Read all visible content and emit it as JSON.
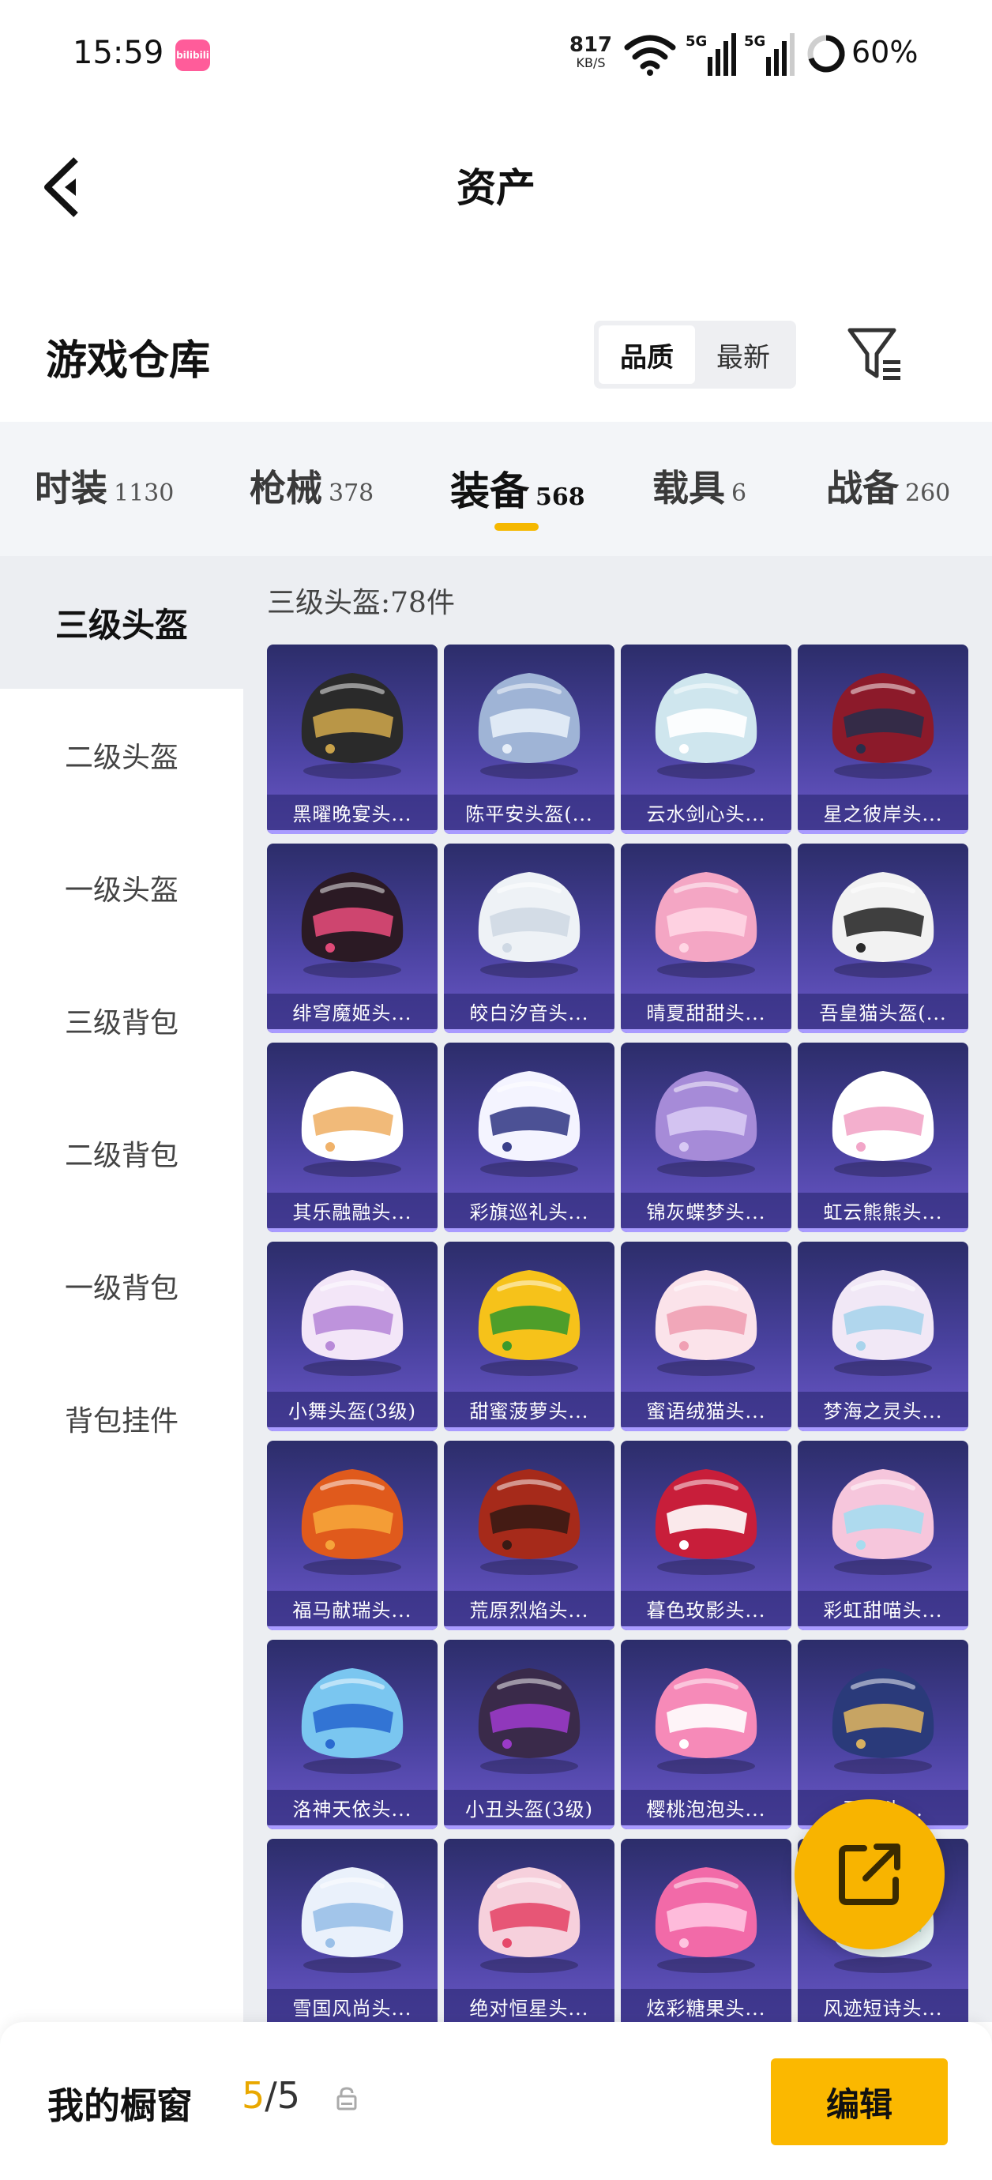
{
  "status_bar": {
    "time": "15:59",
    "app_badge": "bilibili",
    "net_speed_value": "817",
    "net_speed_unit": "KB/S",
    "network_labels": [
      "5G",
      "5G"
    ],
    "battery": "60%"
  },
  "header": {
    "title": "资产",
    "back_icon": "back-arrow-icon"
  },
  "warehouse": {
    "title": "游戏仓库",
    "sort_options": [
      {
        "label": "品质",
        "active": true
      },
      {
        "label": "最新",
        "active": false
      }
    ],
    "filter_icon": "filter-icon"
  },
  "category_tabs": [
    {
      "label": "时装",
      "count": "1130"
    },
    {
      "label": "枪械",
      "count": "378"
    },
    {
      "label": "装备",
      "count": "568",
      "active": true
    },
    {
      "label": "载具",
      "count": "6"
    },
    {
      "label": "战备",
      "count": "260"
    }
  ],
  "side_nav": [
    {
      "label": "三级头盔",
      "active": true
    },
    {
      "label": "二级头盔"
    },
    {
      "label": "一级头盔"
    },
    {
      "label": "三级背包"
    },
    {
      "label": "二级背包"
    },
    {
      "label": "一级背包"
    },
    {
      "label": "背包挂件"
    }
  ],
  "content": {
    "count_label": "三级头盔:78件",
    "items": [
      {
        "name": "黑曜晚宴头...",
        "colors": [
          "#2a2a2a",
          "#c9a24a"
        ]
      },
      {
        "name": "陈平安头盔(...",
        "colors": [
          "#9fb4d6",
          "#e6eef8"
        ]
      },
      {
        "name": "云水剑心头...",
        "colors": [
          "#cfe6ee",
          "#ffffff"
        ]
      },
      {
        "name": "星之彼岸头...",
        "colors": [
          "#8c1a2a",
          "#2a2d4a"
        ]
      },
      {
        "name": "绯穹魔姬头...",
        "colors": [
          "#2b1a24",
          "#e04a78"
        ]
      },
      {
        "name": "皎白汐音头...",
        "colors": [
          "#eef2f6",
          "#cfd9e4"
        ]
      },
      {
        "name": "晴夏甜甜头...",
        "colors": [
          "#f4a6c4",
          "#ffd6e4"
        ]
      },
      {
        "name": "吾皇猫头盔(...",
        "colors": [
          "#f2f2f2",
          "#2b2b2b"
        ]
      },
      {
        "name": "其乐融融头...",
        "colors": [
          "#ffffff",
          "#f0b26a"
        ]
      },
      {
        "name": "彩旗巡礼头...",
        "colors": [
          "#f4f4ff",
          "#3a3f8a"
        ]
      },
      {
        "name": "锦灰蝶梦头...",
        "colors": [
          "#a68bd8",
          "#d8c9f4"
        ]
      },
      {
        "name": "虹云熊熊头...",
        "colors": [
          "#ffffff",
          "#f2a6c8"
        ]
      },
      {
        "name": "小舞头盔(3级)",
        "colors": [
          "#f3e6f8",
          "#b88ad8"
        ]
      },
      {
        "name": "甜蜜菠萝头...",
        "colors": [
          "#f6c21a",
          "#3c9a2c"
        ]
      },
      {
        "name": "蜜语绒猫头...",
        "colors": [
          "#fbe3ea",
          "#f0a0b4"
        ]
      },
      {
        "name": "梦海之灵头...",
        "colors": [
          "#f1e8f6",
          "#a8d4ec"
        ]
      },
      {
        "name": "福马献瑞头...",
        "colors": [
          "#e05a1c",
          "#f6a43a"
        ]
      },
      {
        "name": "荒原烈焰头...",
        "colors": [
          "#a62a1a",
          "#3a1a14"
        ]
      },
      {
        "name": "暮色玫影头...",
        "colors": [
          "#c81e3a",
          "#ffffff"
        ]
      },
      {
        "name": "彩虹甜喵头...",
        "colors": [
          "#f6c6dc",
          "#a6dcef"
        ]
      },
      {
        "name": "洛神天依头...",
        "colors": [
          "#7ac6f0",
          "#2a6ad0"
        ]
      },
      {
        "name": "小丑头盔(3级)",
        "colors": [
          "#3a2a4a",
          "#9a3ac8"
        ]
      },
      {
        "name": "樱桃泡泡头...",
        "colors": [
          "#f68ab8",
          "#ffffff"
        ]
      },
      {
        "name": "画...头...",
        "colors": [
          "#2a3a7a",
          "#d8b060"
        ]
      },
      {
        "name": "雪国风尚头...",
        "colors": [
          "#eaf1fb",
          "#9ac0e8"
        ]
      },
      {
        "name": "绝对恒星头...",
        "colors": [
          "#f6d0dc",
          "#e6486a"
        ]
      },
      {
        "name": "炫彩糖果头...",
        "colors": [
          "#f26aa8",
          "#ffc4e0"
        ]
      },
      {
        "name": "风迹短诗头...",
        "colors": [
          "#e6f2f0",
          "#9ad6c4"
        ]
      }
    ]
  },
  "fab": {
    "icon": "share-icon"
  },
  "bottom_bar": {
    "label": "我的橱窗",
    "count_current": "5",
    "count_sep_total": "/5",
    "lock_icon": "lock-icon",
    "edit_label": "编辑"
  },
  "colors": {
    "accent": "#f8b400",
    "card_top": "#2c2d6a",
    "card_bottom": "#6b58c8"
  }
}
